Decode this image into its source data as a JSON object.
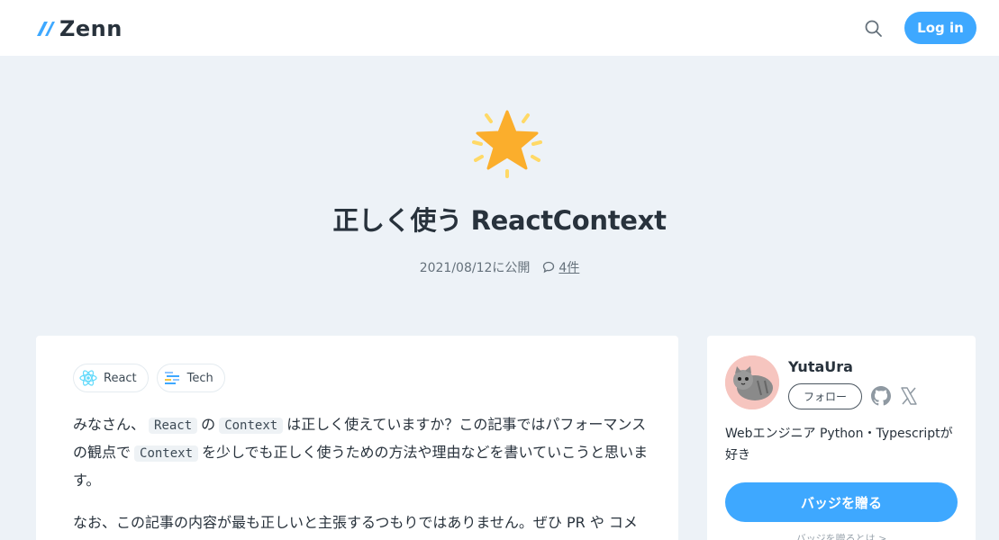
{
  "header": {
    "logo_text": "Zenn",
    "login_label": "Log in"
  },
  "article": {
    "emoji": "star-icon",
    "title": "正しく使う ReactContext",
    "published": "2021/08/12に公開",
    "comments": "4件",
    "tags": [
      {
        "icon": "react-icon",
        "label": "React"
      },
      {
        "icon": "tech-icon",
        "label": "Tech"
      }
    ],
    "body": {
      "p1_a": "みなさん、",
      "p1_code1": "React",
      "p1_b": "の",
      "p1_code2": "Context",
      "p1_c": "は正しく使えていますか？この記事ではパフォーマンスの観点で",
      "p1_code3": "Context",
      "p1_d": "を少しでも正しく使うための方法や理由などを書いていこうと思います。",
      "p2": "なお、この記事の内容が最も正しいと主張するつもりではありません。ぜひ PR や コメ"
    }
  },
  "sidebar": {
    "username": "YutaUra",
    "follow_label": "フォロー",
    "bio": "Webエンジニア Python・Typescriptが好き",
    "badge_button": "バッジを贈る",
    "badge_link": "バッジを贈るとは >"
  },
  "colors": {
    "accent": "#3ea8ff",
    "background": "#edf2f7"
  }
}
